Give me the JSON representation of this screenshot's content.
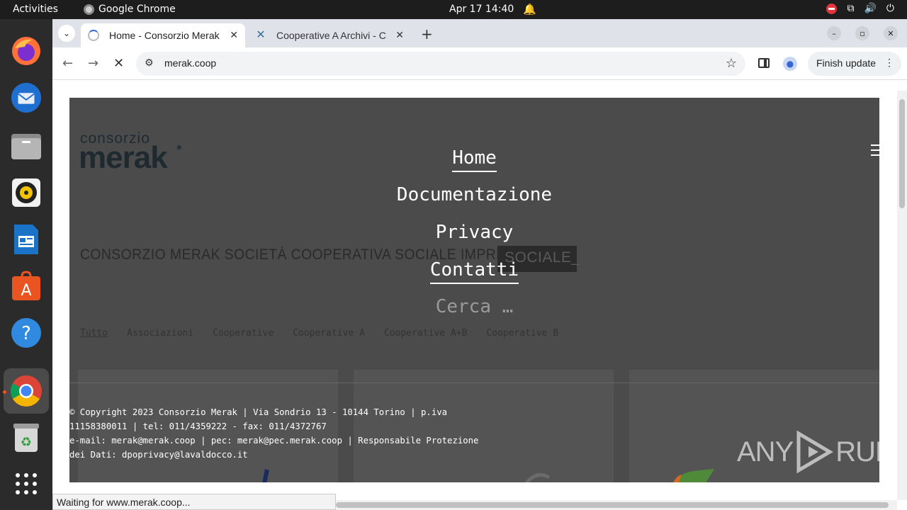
{
  "desktop": {
    "activities_label": "Activities",
    "app_name": "Google Chrome",
    "clock": "Apr 17  14:40",
    "dock_items": [
      "firefox-icon",
      "thunderbird-icon",
      "files-icon",
      "rhythmbox-icon",
      "writer-icon",
      "app-center-icon",
      "help-icon",
      "chrome-icon",
      "trash-icon",
      "app-grid-icon"
    ]
  },
  "browser": {
    "tabs": [
      {
        "title": "Home - Consorzio Merak",
        "state": "loading"
      },
      {
        "title": "Cooperative A Archivi - C",
        "state": "loaded"
      }
    ],
    "url": "merak.coop",
    "finish_update_label": "Finish update",
    "status_text": "Waiting for www.merak.coop..."
  },
  "site": {
    "logo_small": "consorzio",
    "logo_main": "merak",
    "headline": "CONSORZIO MERAK SOCIETÀ COOPERATIVA SOCIALE IMPRESA",
    "headline_highlight": "SOCIALE_",
    "menu": {
      "items": [
        "Home",
        "Documentazione",
        "Privacy",
        "Contatti"
      ],
      "search_placeholder": "Cerca …"
    },
    "filters": [
      "Tutto",
      "Associazioni",
      "Cooperative",
      "Cooperative A",
      "Cooperative A+B",
      "Cooperative B"
    ],
    "footer_lines": [
      "© Copyright 2023 Consorzio Merak | Via Sondrio 13 - 10144 Torino | p.iva",
      "11158380011 | tel: 011/4359222 - fax: 011/4372767",
      "e-mail: merak@merak.coop | pec: merak@pec.merak.coop | Responsabile Protezione",
      "dei Dati: dpoprivacy@lavaldocco.it"
    ],
    "watermark_left": "ANY",
    "watermark_right": "RUN"
  },
  "colors": {
    "overlay_bg": "#4b4b4b",
    "topbar_bg": "#1d1d1d",
    "dock_bg": "#2b2b2b",
    "tabstrip_bg": "#dfe3e9"
  }
}
